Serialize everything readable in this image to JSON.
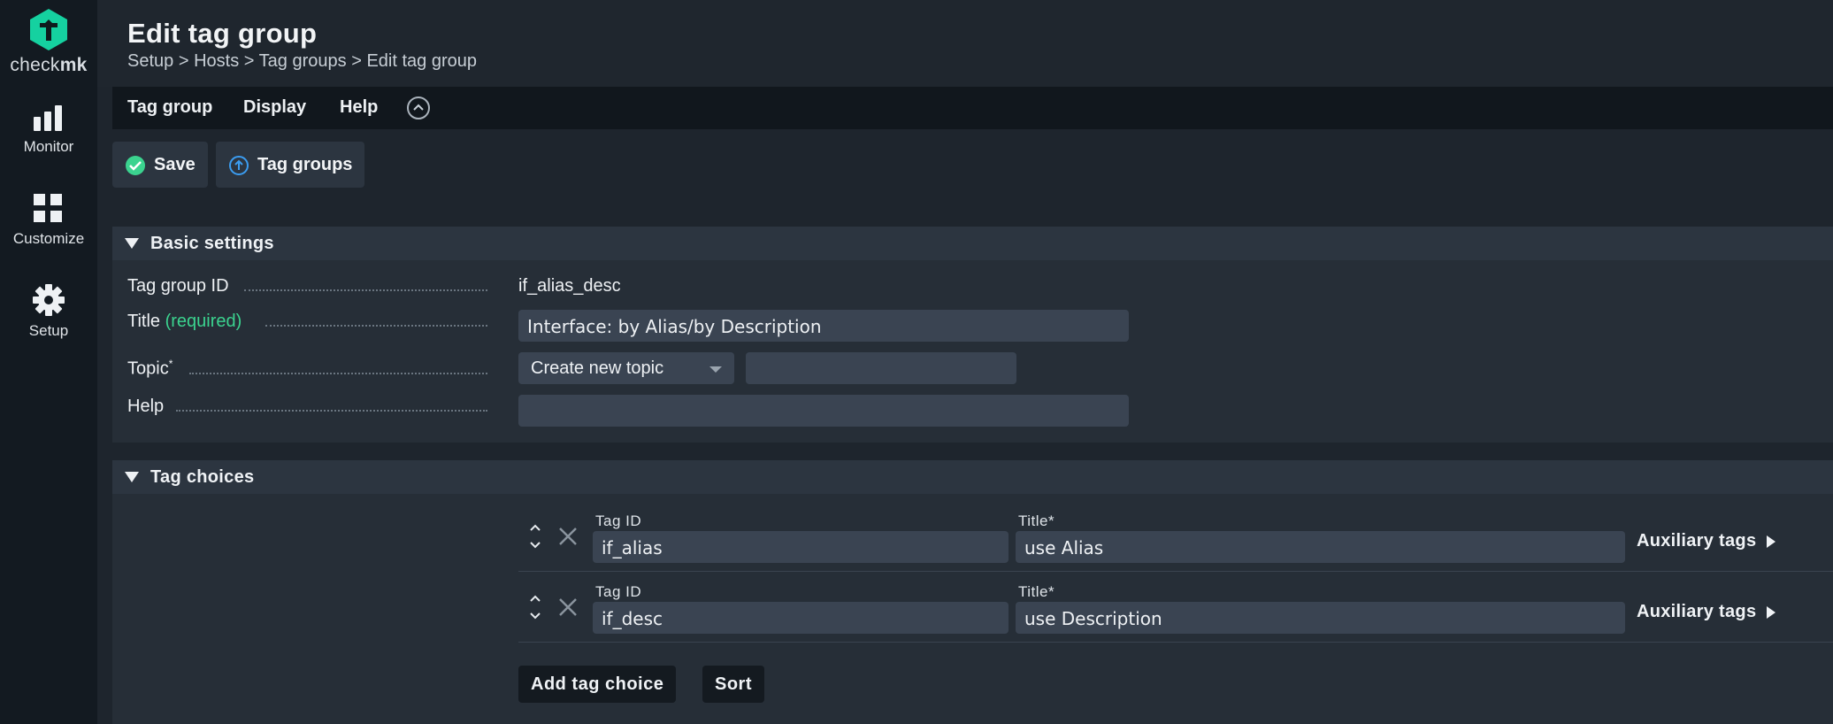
{
  "sidebar": {
    "logo_text_light": "check",
    "logo_text_bold": "mk",
    "items": [
      {
        "label": "Monitor",
        "icon": "bar-chart-icon"
      },
      {
        "label": "Customize",
        "icon": "grid-icon"
      },
      {
        "label": "Setup",
        "icon": "gear-icon"
      }
    ]
  },
  "header": {
    "title": "Edit tag group",
    "breadcrumb": [
      "Setup",
      "Hosts",
      "Tag groups",
      "Edit tag group"
    ],
    "breadcrumb_sep": ">"
  },
  "menu": {
    "items": [
      "Tag group",
      "Display",
      "Help"
    ]
  },
  "toolbar": {
    "save_label": "Save",
    "tag_groups_label": "Tag groups"
  },
  "basic_settings": {
    "title": "Basic settings",
    "tag_group_id_label": "Tag group ID",
    "tag_group_id_value": "if_alias_desc",
    "title_label": "Title",
    "title_required": "(required)",
    "title_value": "Interface: by Alias/by Description",
    "topic_label": "Topic",
    "topic_star": "*",
    "topic_select": "Create new topic",
    "topic_new_value": "",
    "help_label": "Help",
    "help_value": ""
  },
  "tag_choices": {
    "title": "Tag choices",
    "tag_id_label": "Tag ID",
    "title_col_label": "Title*",
    "aux_label": "Auxiliary tags",
    "rows": [
      {
        "tag_id": "if_alias",
        "title": "use Alias"
      },
      {
        "tag_id": "if_desc",
        "title": "use Description"
      }
    ],
    "add_label": "Add tag choice",
    "sort_label": "Sort"
  },
  "colors": {
    "accent_green": "#3bd38f",
    "logo_green": "#15d1a0",
    "background": "#1e252d"
  }
}
